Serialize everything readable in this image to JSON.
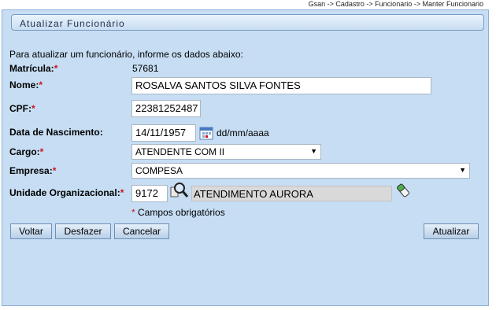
{
  "breadcrumb": "Gsan -> Cadastro -> Funcionario -> Manter Funcionario",
  "title": "Atualizar Funcionário",
  "intro": "Para atualizar um funcionário, informe os dados abaixo:",
  "fields": {
    "matricula": {
      "label": "Matrícula:",
      "req": "*",
      "value": "57681"
    },
    "nome": {
      "label": "Nome:",
      "req": "*",
      "value": "ROSALVA SANTOS SILVA FONTES"
    },
    "cpf": {
      "label": "CPF:",
      "req": "*",
      "value": "22381252487"
    },
    "nascimento": {
      "label": "Data de Nascimento:",
      "value": "14/11/1957",
      "hint": "dd/mm/aaaa"
    },
    "cargo": {
      "label": "Cargo:",
      "req": "*",
      "value": "ATENDENTE COM II"
    },
    "empresa": {
      "label": "Empresa:",
      "req": "*",
      "value": "COMPESA"
    },
    "unidade": {
      "label": "Unidade Organizacional:",
      "req": "*",
      "code": "9172",
      "name": "ATENDIMENTO AURORA"
    }
  },
  "required_note": {
    "star": "*",
    "text": " Campos obrigatórios"
  },
  "buttons": {
    "voltar": "Voltar",
    "desfazer": "Desfazer",
    "cancelar": "Cancelar",
    "atualizar": "Atualizar"
  },
  "icons": {
    "calendar": "calendar-icon",
    "search": "magnifier-icon",
    "clear": "eraser-icon"
  }
}
